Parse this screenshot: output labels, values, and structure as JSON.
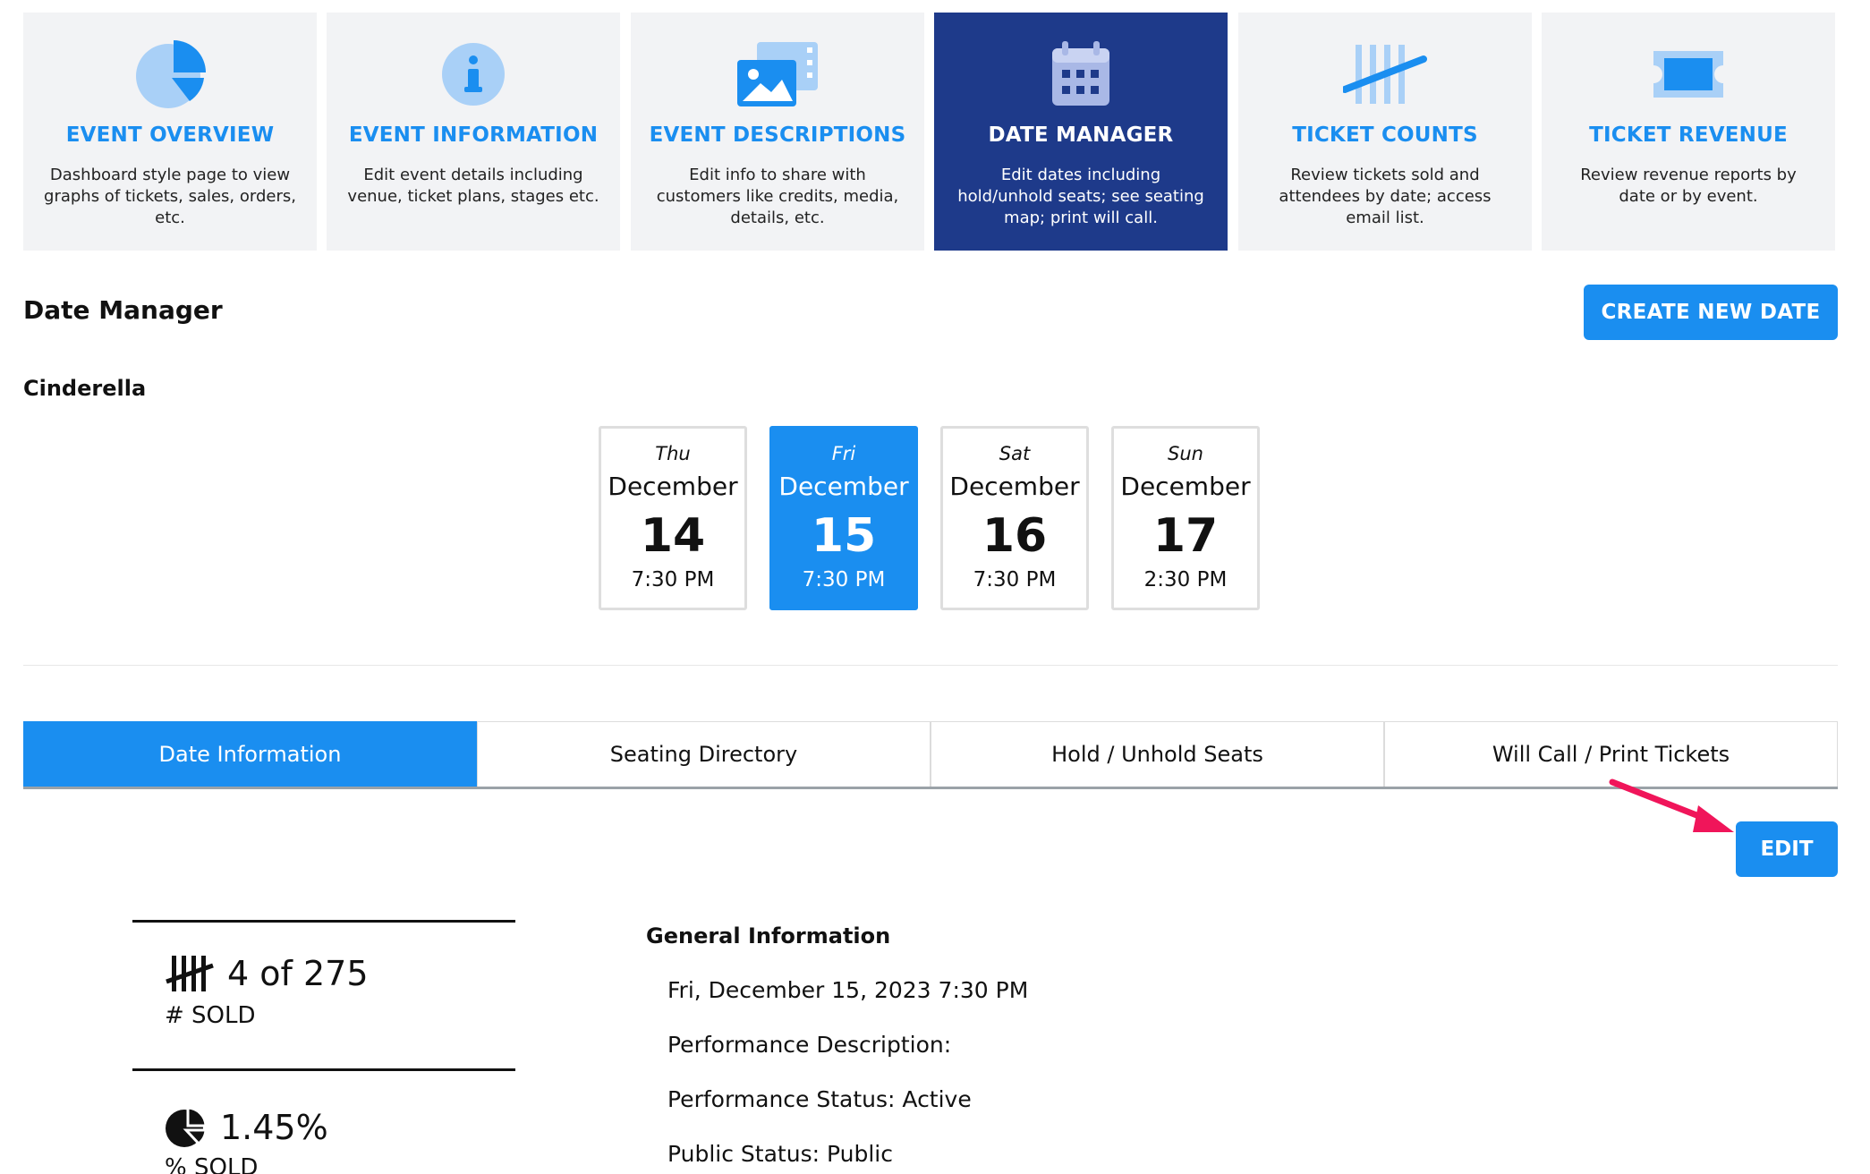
{
  "nav_cards": [
    {
      "title": "EVENT OVERVIEW",
      "description": "Dashboard style page to view graphs of tickets, sales, orders, etc.",
      "icon": "pie-chart-icon",
      "active": false
    },
    {
      "title": "EVENT INFORMATION",
      "description": "Edit event details including venue, ticket plans, stages etc.",
      "icon": "info-icon",
      "active": false
    },
    {
      "title": "EVENT DESCRIPTIONS",
      "description": "Edit info to share with customers like credits, media, details, etc.",
      "icon": "media-icon",
      "active": false
    },
    {
      "title": "DATE MANAGER",
      "description": "Edit dates including hold/unhold seats; see seating map; print will call.",
      "icon": "calendar-icon",
      "active": true
    },
    {
      "title": "TICKET COUNTS",
      "description": "Review tickets sold and attendees by date; access email list.",
      "icon": "tally-icon",
      "active": false
    },
    {
      "title": "TICKET REVENUE",
      "description": "Review revenue reports by date or by event.",
      "icon": "ticket-icon",
      "active": false
    }
  ],
  "page": {
    "title": "Date Manager",
    "create_button": "CREATE NEW DATE",
    "event_name": "Cinderella"
  },
  "dates": [
    {
      "dow": "Thu",
      "month": "December",
      "day": "14",
      "time": "7:30 PM",
      "selected": false
    },
    {
      "dow": "Fri",
      "month": "December",
      "day": "15",
      "time": "7:30 PM",
      "selected": true
    },
    {
      "dow": "Sat",
      "month": "December",
      "day": "16",
      "time": "7:30 PM",
      "selected": false
    },
    {
      "dow": "Sun",
      "month": "December",
      "day": "17",
      "time": "2:30 PM",
      "selected": false
    }
  ],
  "tabs": [
    {
      "label": "Date Information",
      "active": true
    },
    {
      "label": "Seating Directory",
      "active": false
    },
    {
      "label": "Hold / Unhold Seats",
      "active": false
    },
    {
      "label": "Will Call / Print Tickets",
      "active": false
    }
  ],
  "edit_button": "EDIT",
  "stats": {
    "sold": {
      "value": "4 of 275",
      "label": "# SOLD",
      "icon": "tally-icon"
    },
    "percent": {
      "value": "1.45%",
      "label": "% SOLD",
      "icon": "pie-chart-icon"
    }
  },
  "general_info": {
    "title": "General Information",
    "lines": [
      "Fri, December 15, 2023 7:30 PM",
      "Performance Description:",
      "Performance Status: Active",
      "Public Status: Public"
    ]
  },
  "colors": {
    "primary": "#1a8ef0",
    "active_nav": "#1e3a8a",
    "card_bg": "#f2f3f5",
    "annotation_arrow": "#f0155a"
  }
}
